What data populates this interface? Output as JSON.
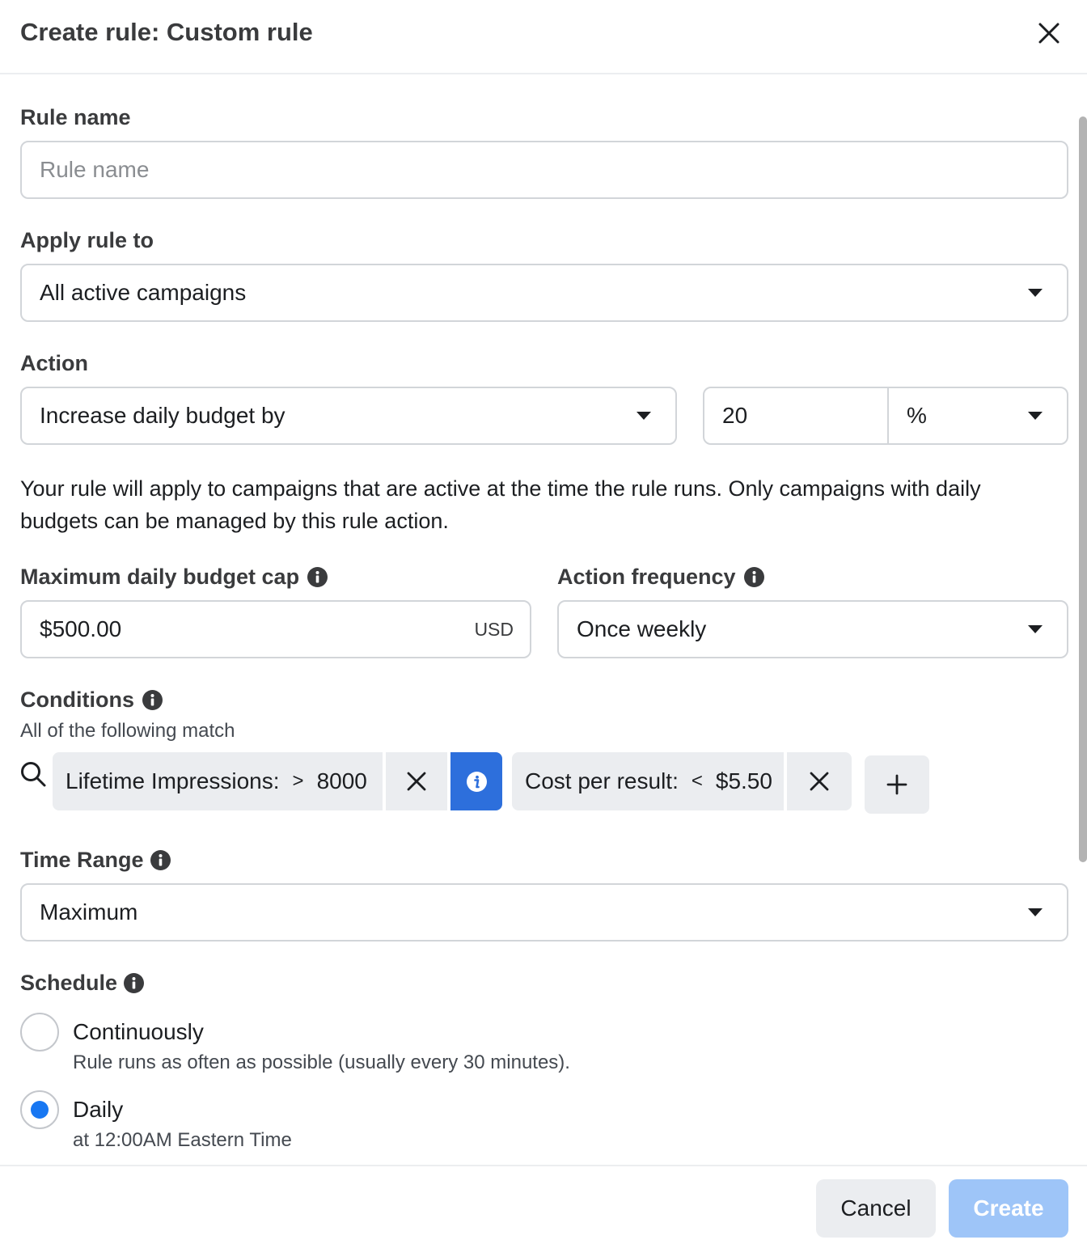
{
  "dialog": {
    "title": "Create rule: Custom rule"
  },
  "rule_name": {
    "label": "Rule name",
    "placeholder": "Rule name",
    "value": ""
  },
  "apply_rule_to": {
    "label": "Apply rule to",
    "value": "All active campaigns"
  },
  "action": {
    "label": "Action",
    "value": "Increase daily budget by",
    "amount": "20",
    "unit": "%"
  },
  "description": "Your rule will apply to campaigns that are active at the time the rule runs. Only campaigns with daily budgets can be managed by this rule action.",
  "budget_cap": {
    "label": "Maximum daily budget cap",
    "value": "$500.00",
    "currency": "USD"
  },
  "action_frequency": {
    "label": "Action frequency",
    "value": "Once weekly"
  },
  "conditions": {
    "label": "Conditions",
    "subtitle": "All of the following match",
    "items": [
      {
        "metric": "Lifetime Impressions:",
        "operator": ">",
        "value": "8000"
      },
      {
        "metric": "Cost per result:",
        "operator": "<",
        "value": "$5.50"
      }
    ]
  },
  "time_range": {
    "label": "Time Range",
    "value": "Maximum"
  },
  "schedule": {
    "label": "Schedule",
    "options": [
      {
        "label": "Continuously",
        "description": "Rule runs as often as possible (usually every 30 minutes).",
        "selected": false
      },
      {
        "label": "Daily",
        "description": "at 12:00AM Eastern Time",
        "selected": true
      }
    ]
  },
  "footer": {
    "cancel_label": "Cancel",
    "create_label": "Create"
  },
  "colors": {
    "accent": "#1877f2",
    "info_chip": "#2d6fdc",
    "create_disabled": "#9ec5f8"
  }
}
